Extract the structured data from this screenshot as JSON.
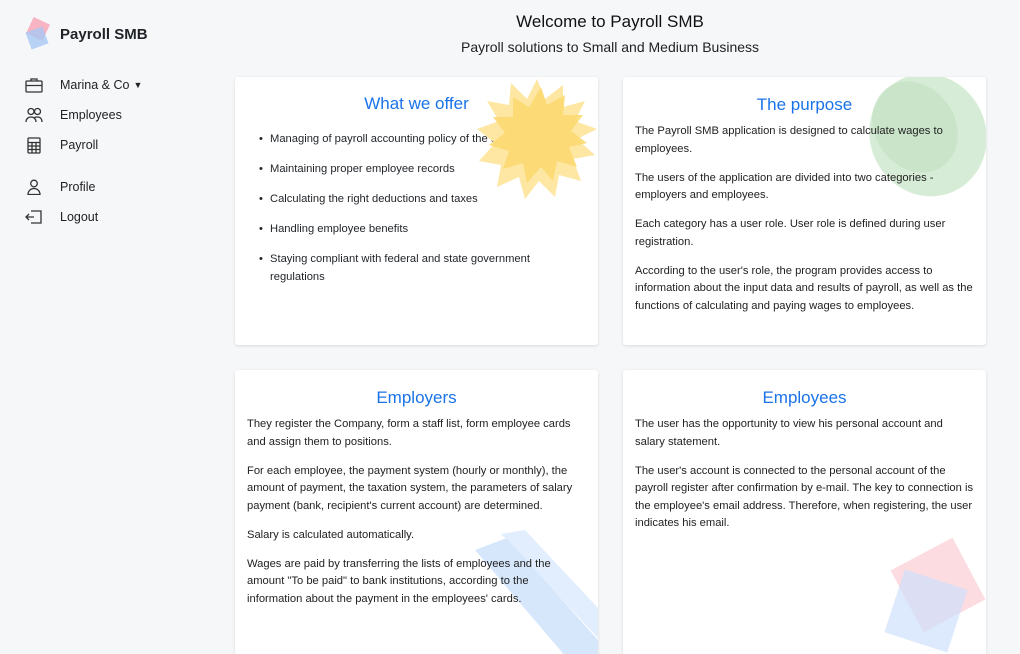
{
  "brand": {
    "name": "Payroll SMB"
  },
  "sidebar": {
    "items": [
      {
        "label": "Marina & Co",
        "icon": "briefcase-icon",
        "dropdown": true
      },
      {
        "label": "Employees",
        "icon": "people-icon"
      },
      {
        "label": "Payroll",
        "icon": "calculator-icon"
      },
      {
        "label": "Profile",
        "icon": "person-icon"
      },
      {
        "label": "Logout",
        "icon": "logout-icon"
      }
    ]
  },
  "header": {
    "title": "Welcome to Payroll SMB",
    "subtitle": "Payroll solutions to Small and Medium Business"
  },
  "cards": {
    "offer": {
      "title": "What we offer",
      "items": [
        "Managing of payroll accounting policy of the company",
        "Maintaining proper employee records",
        "Calculating the right deductions and taxes",
        "Handling employee benefits",
        "Staying compliant with federal and state government regulations"
      ]
    },
    "purpose": {
      "title": "The purpose",
      "paragraphs": [
        "The Payroll SMB application is designed to calculate wages to employees.",
        "The users of the application are divided into two categories - employers and employees.",
        "Each category has a user role. User role is defined during user registration.",
        "According to the user's role, the program provides access to information about the input data and results of payroll, as well as the functions of calculating and paying wages to employees."
      ]
    },
    "employers": {
      "title": "Employers",
      "paragraphs": [
        "They register the Company, form a staff list, form employee cards and assign them to positions.",
        "For each employee, the payment system (hourly or monthly), the amount of payment, the taxation system, the parameters of salary payment (bank, recipient's current account) are determined.",
        "Salary is calculated automatically.",
        "Wages are paid by transferring the lists of employees and the amount \"To be paid\" to bank institutions, according to the information about the payment in the employees' cards."
      ]
    },
    "employees": {
      "title": "Employees",
      "paragraphs": [
        "The user has the opportunity to view his personal account and salary statement.",
        "The user's account is connected to the personal account of the payroll register after confirmation by e-mail. The key to connection is the employee's email address. Therefore, when registering, the user indicates his email."
      ]
    }
  },
  "colors": {
    "accent": "#1a73e8",
    "background": "#f6f7f9"
  }
}
